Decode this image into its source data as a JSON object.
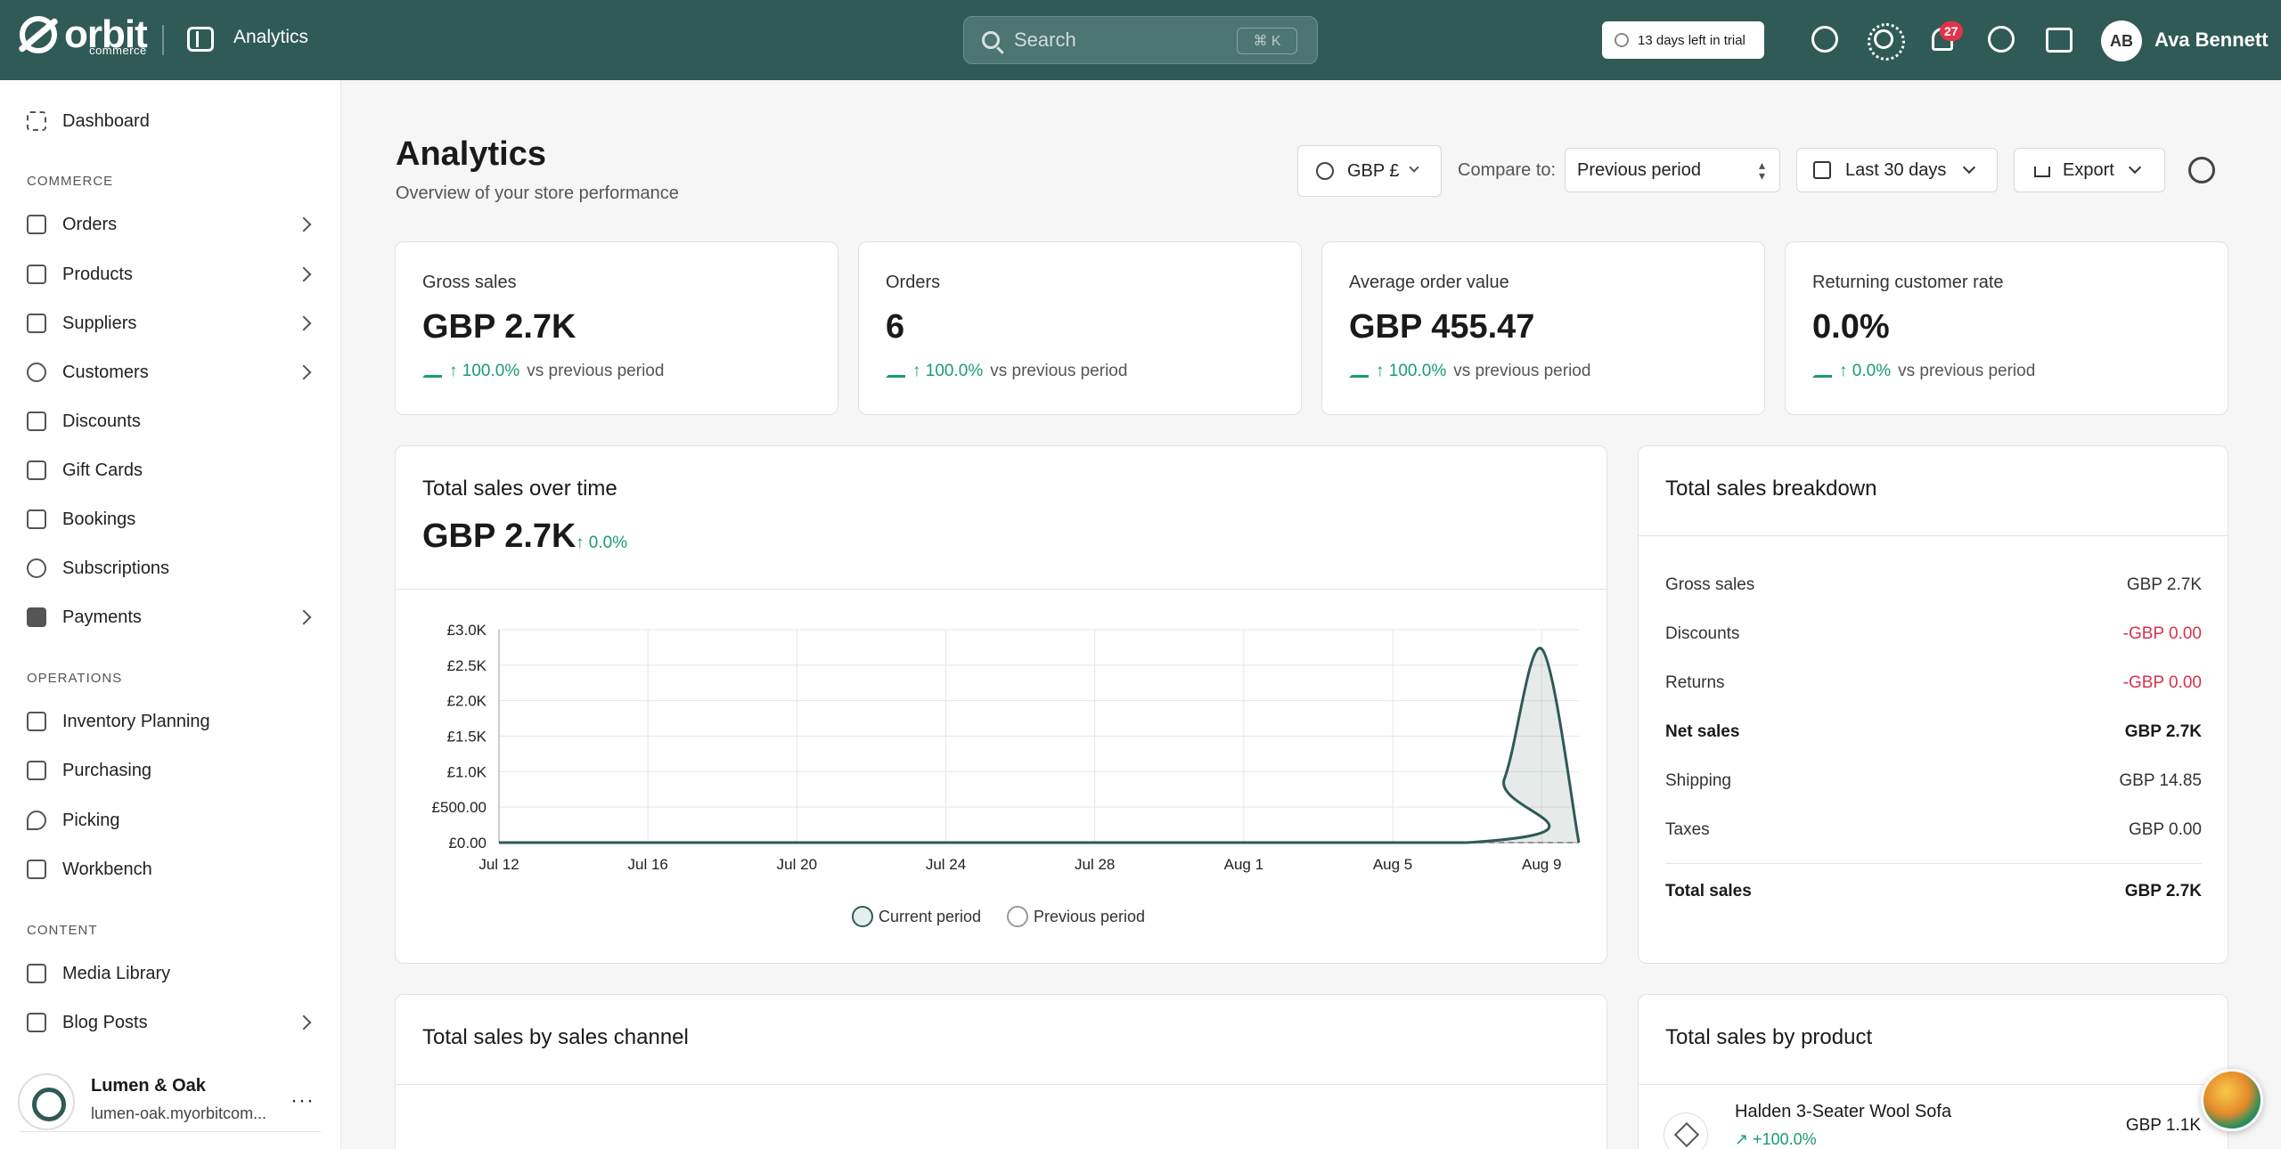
{
  "header": {
    "brand": "orbit",
    "brand_sub": "commerce",
    "section": "Analytics",
    "search_placeholder": "Search",
    "search_shortcut": "⌘ K",
    "trial": "13 days left in trial",
    "notifications_count": "27",
    "user_initials": "AB",
    "user_name": "Ava Bennett"
  },
  "sidebar": {
    "dashboard": "Dashboard",
    "sections": [
      {
        "title": "COMMERCE",
        "items": [
          {
            "label": "Orders",
            "icon": "orders-icon",
            "expandable": true
          },
          {
            "label": "Products",
            "icon": "box-icon",
            "expandable": true
          },
          {
            "label": "Suppliers",
            "icon": "building-icon",
            "expandable": true
          },
          {
            "label": "Customers",
            "icon": "users-icon",
            "expandable": true
          },
          {
            "label": "Discounts",
            "icon": "tag-icon",
            "expandable": false
          },
          {
            "label": "Gift Cards",
            "icon": "gift-icon",
            "expandable": false
          },
          {
            "label": "Bookings",
            "icon": "calendar-icon",
            "expandable": false
          },
          {
            "label": "Subscriptions",
            "icon": "refresh-icon",
            "expandable": false
          },
          {
            "label": "Payments",
            "icon": "card-icon",
            "expandable": true
          }
        ]
      },
      {
        "title": "OPERATIONS",
        "items": [
          {
            "label": "Inventory Planning",
            "icon": "clipboard-icon"
          },
          {
            "label": "Purchasing",
            "icon": "box-icon"
          },
          {
            "label": "Picking",
            "icon": "pin-icon"
          },
          {
            "label": "Workbench",
            "icon": "box-icon"
          }
        ]
      },
      {
        "title": "CONTENT",
        "items": [
          {
            "label": "Media Library",
            "icon": "image-icon"
          },
          {
            "label": "Blog Posts",
            "icon": "document-icon",
            "expandable": true
          }
        ]
      }
    ],
    "store_name": "Lumen & Oak",
    "store_url": "lumen-oak.myorbitcom..."
  },
  "page": {
    "title": "Analytics",
    "subtitle": "Overview of your store performance",
    "currency": "GBP £",
    "compare_label": "Compare to:",
    "compare_value": "Previous period",
    "date_range": "Last 30 days",
    "export": "Export"
  },
  "kpis": [
    {
      "label": "Gross sales",
      "value": "GBP 2.7K",
      "change": "100.0%",
      "suffix": "vs previous period"
    },
    {
      "label": "Orders",
      "value": "6",
      "change": "100.0%",
      "suffix": "vs previous period"
    },
    {
      "label": "Average order value",
      "value": "GBP 455.47",
      "change": "100.0%",
      "suffix": "vs previous period"
    },
    {
      "label": "Returning customer rate",
      "value": "0.0%",
      "change": "0.0%",
      "suffix": "vs previous period"
    }
  ],
  "sales_chart": {
    "title": "Total sales over time",
    "total": "GBP 2.7K",
    "change": "0.0%",
    "legend_current": "Current period",
    "legend_previous": "Previous period"
  },
  "chart_data": {
    "type": "area",
    "title": "Total sales over time",
    "x_tick_labels": [
      "Jul 12",
      "Jul 16",
      "Jul 20",
      "Jul 24",
      "Jul 28",
      "Aug 1",
      "Aug 5",
      "Aug 9"
    ],
    "y_tick_labels": [
      "£0.00",
      "£500.00",
      "£1.0K",
      "£1.5K",
      "£2.0K",
      "£2.5K",
      "£3.0K"
    ],
    "ylim": [
      0,
      3000
    ],
    "x_range": [
      "2024-07-12",
      "2024-08-10"
    ],
    "grid": true,
    "legend_position": "bottom",
    "series": [
      {
        "name": "Current period",
        "color": "#2f5a56",
        "x": [
          "2024-07-12",
          "2024-08-07",
          "2024-08-08",
          "2024-08-09",
          "2024-08-10"
        ],
        "y": [
          0,
          0,
          900,
          2730,
          0
        ]
      },
      {
        "name": "Previous period",
        "color": "#999999",
        "x": [
          "2024-07-12",
          "2024-08-10"
        ],
        "y": [
          0,
          0
        ]
      }
    ]
  },
  "breakdown": {
    "title": "Total sales breakdown",
    "rows": [
      {
        "label": "Gross sales",
        "value": "GBP 2.7K",
        "style": "normal"
      },
      {
        "label": "Discounts",
        "value": "-GBP 0.00",
        "style": "negative"
      },
      {
        "label": "Returns",
        "value": "-GBP 0.00",
        "style": "negative"
      },
      {
        "label": "Net sales",
        "value": "GBP 2.7K",
        "style": "bold"
      },
      {
        "label": "Shipping",
        "value": "GBP 14.85",
        "style": "normal"
      },
      {
        "label": "Taxes",
        "value": "GBP 0.00",
        "style": "normal"
      },
      {
        "label": "Total sales",
        "value": "GBP 2.7K",
        "style": "bold"
      }
    ]
  },
  "channel": {
    "title": "Total sales by sales channel"
  },
  "by_product": {
    "title": "Total sales by product",
    "items": [
      {
        "name": "Halden 3-Seater Wool Sofa",
        "change": "+100.0%",
        "value": "GBP 1.1K"
      }
    ]
  },
  "colors": {
    "brand": "#2f5a56",
    "positive": "#1a9b73",
    "negative": "#d6324f"
  }
}
